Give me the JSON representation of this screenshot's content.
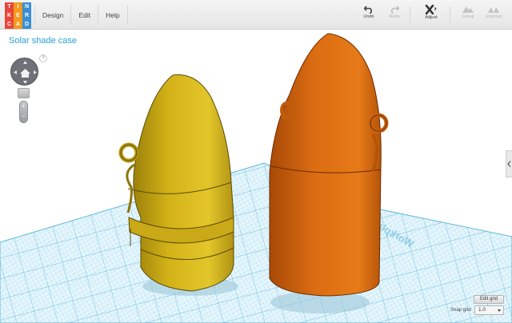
{
  "app": {
    "logo": {
      "letters": [
        "T",
        "I",
        "N",
        "K",
        "E",
        "R",
        "C",
        "A",
        "D"
      ],
      "colors": [
        "#e8463a",
        "#f39a1f",
        "#3a8fd4",
        "#e8463a",
        "#f39a1f",
        "#3a8fd4",
        "#e8463a",
        "#f39a1f",
        "#3a8fd4"
      ]
    },
    "menu": [
      "Design",
      "Edit",
      "Help"
    ]
  },
  "toolbar": {
    "undo": {
      "label": "Undo",
      "icon": "undo-icon",
      "enabled": true
    },
    "redo": {
      "label": "Redo",
      "icon": "redo-icon",
      "enabled": false
    },
    "adjust": {
      "label": "Adjust",
      "icon": "adjust-icon",
      "enabled": true
    },
    "group": {
      "label": "Group",
      "icon": "group-icon",
      "enabled": false
    },
    "ungroup": {
      "label": "Ungroup",
      "icon": "ungroup-icon",
      "enabled": false
    }
  },
  "design": {
    "title": "Solar shade case"
  },
  "view_controls": {
    "help": "?",
    "zoom_in": "+",
    "zoom_out": "−",
    "icons": [
      "nav-cube-icon",
      "home-view-icon",
      "help-icon"
    ]
  },
  "workplane": {
    "label": "Workplane",
    "color": "#8fd0ea"
  },
  "objects": [
    {
      "name": "yellow-case-part",
      "color": "#cfae12"
    },
    {
      "name": "orange-case-part",
      "color": "#d5650e"
    }
  ],
  "grid_controls": {
    "edit_grid_label": "Edit grid",
    "snap_grid_label": "Snap grid",
    "snap_grid_value": "1.0"
  }
}
